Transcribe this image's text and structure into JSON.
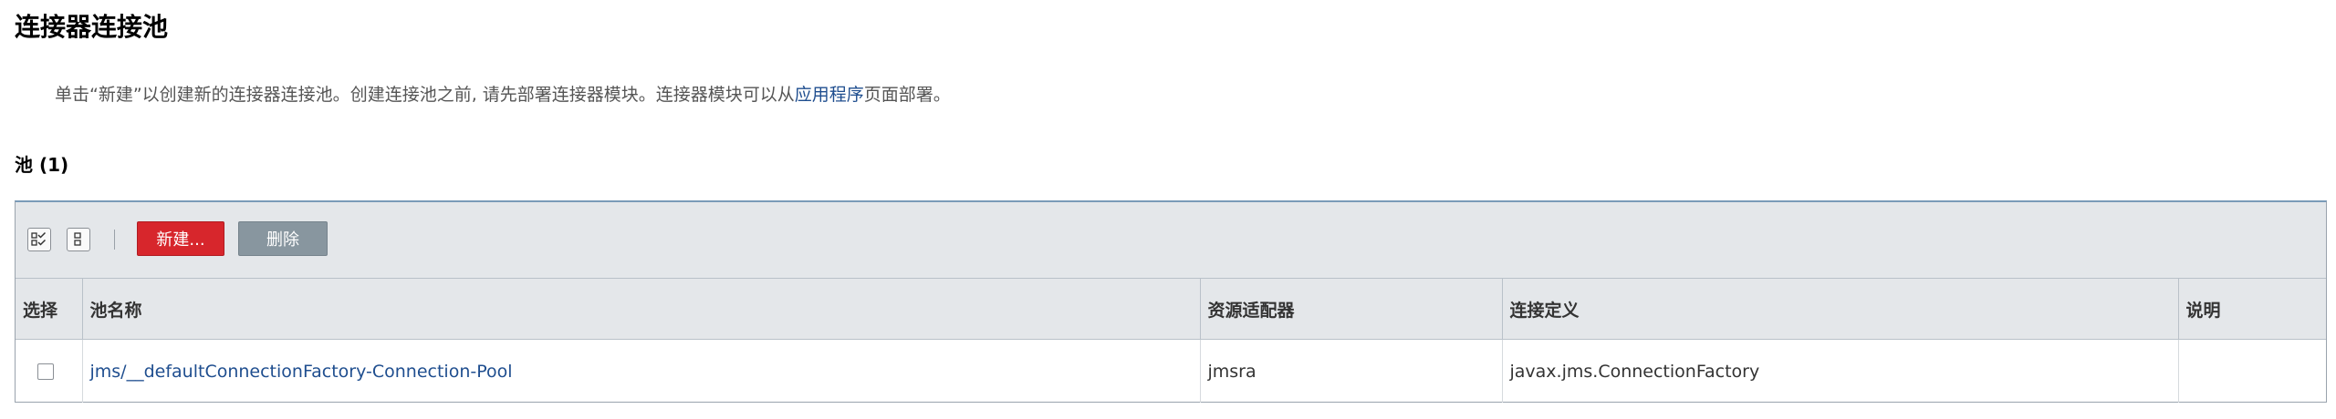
{
  "page": {
    "title": "连接器连接池",
    "help": {
      "prefix": "单击“新建”以创建新的连接器连接池。创建连接池之前, 请先部署连接器模块。连接器模块可以从",
      "link": "应用程序",
      "suffix": "页面部署。"
    }
  },
  "table": {
    "section_title": "池 (1)",
    "toolbar": {
      "select_all_icon": "select-all-icon",
      "deselect_all_icon": "deselect-all-icon",
      "new_label": "新建...",
      "delete_label": "删除"
    },
    "columns": [
      "选择",
      "池名称",
      "资源适配器",
      "连接定义",
      "说明"
    ],
    "rows": [
      {
        "selected": false,
        "pool_name": "jms/__defaultConnectionFactory-Connection-Pool",
        "resource_adapter": "jmsra",
        "connection_definition": "javax.jms.ConnectionFactory",
        "description": ""
      }
    ]
  },
  "colors": {
    "accent_red": "#d7262c",
    "link_blue": "#1f4e8f",
    "disabled_gray": "#88969f",
    "header_bg": "#e4e7ea"
  }
}
